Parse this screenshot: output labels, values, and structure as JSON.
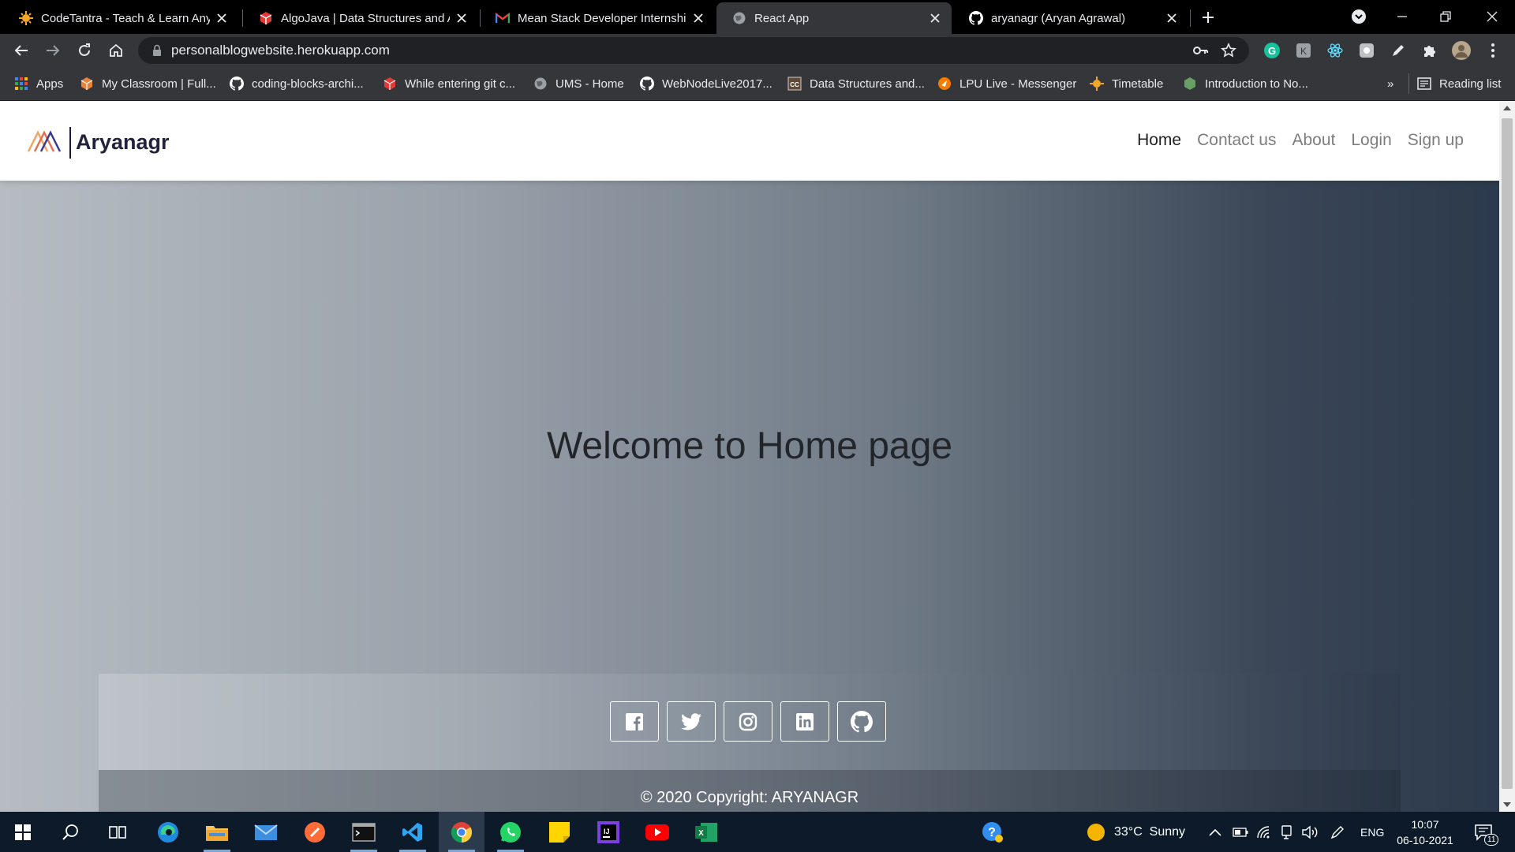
{
  "browser": {
    "tabs": [
      {
        "title": "CodeTantra - Teach & Learn Anywhere"
      },
      {
        "title": "AlgoJava | Data Structures and Algorithms"
      },
      {
        "title": "Mean Stack Developer Internship"
      },
      {
        "title": "React App"
      },
      {
        "title": "aryanagr (Aryan Agrawal)"
      }
    ],
    "url": "personalblogwebsite.herokuapp.com",
    "bookmarks": [
      {
        "label": "Apps"
      },
      {
        "label": "My Classroom | Full..."
      },
      {
        "label": "coding-blocks-archi..."
      },
      {
        "label": "While entering git c..."
      },
      {
        "label": "UMS - Home"
      },
      {
        "label": "WebNodeLive2017..."
      },
      {
        "label": "Data Structures and..."
      },
      {
        "label": "LPU Live - Messenger"
      },
      {
        "label": "Timetable"
      },
      {
        "label": "Introduction to No..."
      }
    ],
    "bookmarks_overflow": "»",
    "reading_list": "Reading list"
  },
  "page": {
    "brand": "Aryanagr",
    "nav": [
      "Home",
      "Contact us",
      "About",
      "Login",
      "Sign up"
    ],
    "hero_title": "Welcome to Home page",
    "footer_copyright": "© 2020 Copyright: ARYANAGR",
    "social": [
      "facebook-icon",
      "twitter-icon",
      "instagram-icon",
      "linkedin-icon",
      "github-icon"
    ]
  },
  "taskbar": {
    "weather": "33°C  Sunny",
    "language": "ENG",
    "time": "10:07",
    "date": "06-10-2021",
    "notifications": "11"
  },
  "colors": {
    "accent": "#1a73e8",
    "taskbar": "#0c1a2a"
  }
}
